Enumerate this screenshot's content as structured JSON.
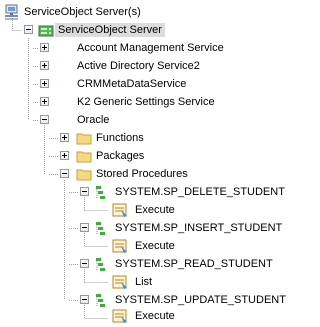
{
  "tree": {
    "root": {
      "label": "ServiceObject Server(s)",
      "icon": "server-network-icon"
    },
    "server": {
      "label": "ServiceObject Server",
      "icon": "green-server-icon",
      "selected": true
    },
    "services": [
      {
        "label": "Account Management Service",
        "expanded": false
      },
      {
        "label": "Active Directory Service2",
        "expanded": false
      },
      {
        "label": "CRMMetaDataService",
        "expanded": false
      },
      {
        "label": "K2 Generic Settings Service",
        "expanded": false
      },
      {
        "label": "Oracle",
        "expanded": true
      }
    ],
    "oracle_children": [
      {
        "label": "Functions",
        "icon": "folder-icon",
        "expanded": false
      },
      {
        "label": "Packages",
        "icon": "folder-icon",
        "expanded": false
      },
      {
        "label": "Stored Procedures",
        "icon": "folder-icon",
        "expanded": true
      }
    ],
    "procedures": [
      {
        "label": "SYSTEM.SP_DELETE_STUDENT",
        "method": "Execute"
      },
      {
        "label": "SYSTEM.SP_INSERT_STUDENT",
        "method": "Execute"
      },
      {
        "label": "SYSTEM.SP_READ_STUDENT",
        "method": "List"
      },
      {
        "label": "SYSTEM.SP_UPDATE_STUDENT",
        "method": "Execute"
      }
    ]
  },
  "colors": {
    "selection_bg": "#dcdcdc",
    "tree_lines": "#a0a0a0",
    "folder": "#f5d980",
    "server_green": "#3fae3f",
    "method_icon": "#c8a040"
  }
}
